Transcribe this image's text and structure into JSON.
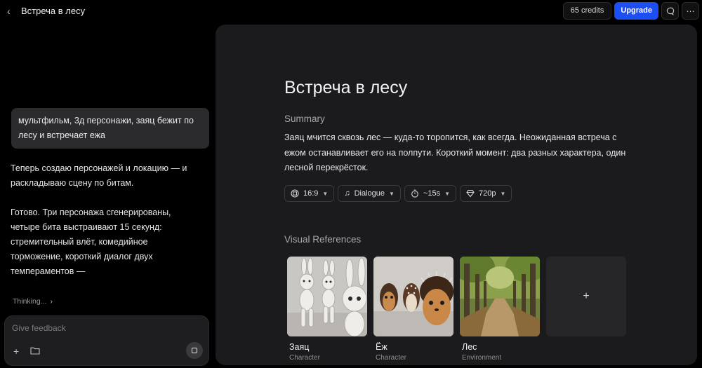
{
  "header": {
    "title": "Встреча в лесу",
    "credits": "65 credits",
    "upgrade": "Upgrade"
  },
  "chat": {
    "user_message": "мультфильм, 3д персонажи, заяц бежит по лесу и встречает ежа",
    "ai_paragraph_1": "Теперь создаю персонажей и локацию — и раскладываю сцену по битам.",
    "ai_paragraph_2": "Готово. Три персонажа сгенерированы, четыре бита выстраивают 15 секунд: стремительный влёт, комедийное торможение, короткий диалог двух темпераментов —",
    "thinking": "Thinking...",
    "composer_placeholder": "Give feedback"
  },
  "doc": {
    "title": "Встреча в лесу",
    "summary_heading": "Summary",
    "summary_text": "Заяц мчится сквозь лес — куда-то торопится, как всегда. Неожиданная встреча с ежом останавливает его на полпути. Короткий момент: два разных характера, один лесной перекрёсток.",
    "options": {
      "aspect": "16:9",
      "mode": "Dialogue",
      "duration": "~15s",
      "quality": "720p"
    },
    "visual_refs_heading": "Visual References",
    "refs": [
      {
        "name": "Заяц",
        "type": "Character"
      },
      {
        "name": "Ёж",
        "type": "Character"
      },
      {
        "name": "Лес",
        "type": "Environment"
      }
    ],
    "add_symbol": "+"
  },
  "icons": {
    "back": "chevron-left-icon",
    "feedback": "chat-bubble-icon",
    "more": "ellipsis-icon",
    "aspect": "aspect-ratio-icon",
    "mode": "music-note-icon",
    "duration": "stopwatch-icon",
    "quality": "diamond-icon"
  },
  "colors": {
    "accent": "#1d4ef2",
    "panel": "#1b1b1d",
    "background": "#000000"
  }
}
